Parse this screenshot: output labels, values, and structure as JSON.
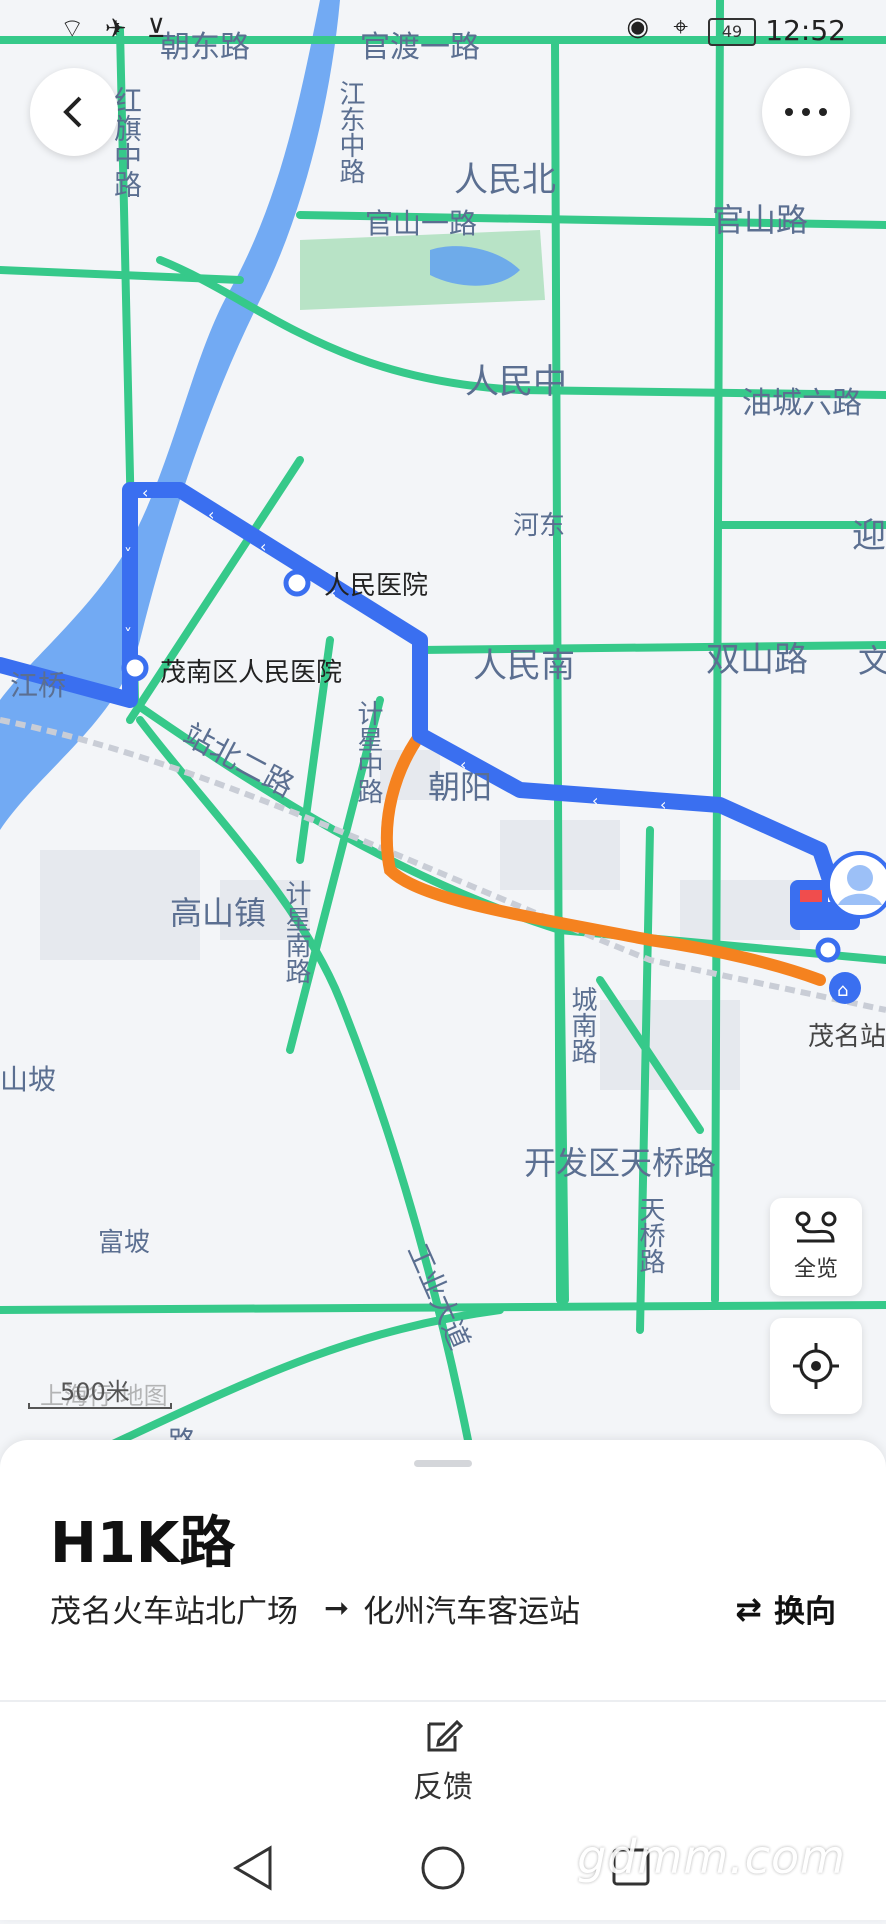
{
  "status_bar": {
    "time": "12:52",
    "battery": "49"
  },
  "map": {
    "road_labels": [
      "朝东路",
      "官渡一路",
      "江东中路",
      "官山一路",
      "官山路",
      "红旗中路",
      "人民北",
      "人民中",
      "油城六路",
      "河东",
      "人民南",
      "双山路",
      "文",
      "迎",
      "站北二路",
      "计星中路",
      "朝阳",
      "高山镇",
      "计星南路",
      "城南路",
      "开发区天桥路",
      "天桥路",
      "山坡",
      "富坡",
      "工业大道",
      "江桥",
      "路"
    ],
    "stops": [
      "人民医院",
      "茂南区人民医院",
      "茂名站"
    ],
    "scale": "500米",
    "brand": "上海行 地图"
  },
  "controls": {
    "overview_label": "全览"
  },
  "colors": {
    "route": "#3a6ff0",
    "road": "#36c98a",
    "orange": "#f5821f",
    "river": "#5b9cf2",
    "park": "#b8e3c6"
  },
  "route": {
    "name": "H1K路",
    "from": "茂名火车站北广场",
    "to": "化州汽车客运站",
    "switch_label": "换向"
  },
  "footer": {
    "feedback_label": "反馈"
  },
  "watermark": "gdmm.com"
}
